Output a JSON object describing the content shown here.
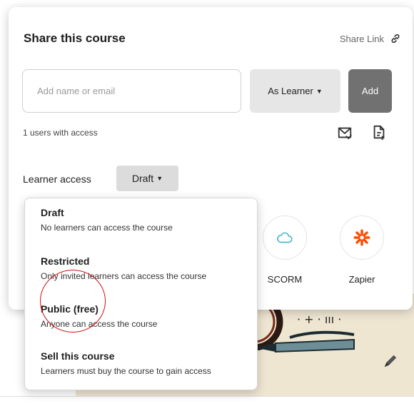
{
  "modal": {
    "title": "Share this course",
    "share_link_label": "Share Link"
  },
  "invite": {
    "placeholder": "Add name or email",
    "role_label": "As Learner",
    "add_label": "Add"
  },
  "users_count_text": "1 users with access",
  "access": {
    "label": "Learner access",
    "current": "Draft"
  },
  "integrations": [
    {
      "name": "SCORM",
      "icon": "cloud-icon",
      "color": "#45b7c4"
    },
    {
      "name": "Zapier",
      "icon": "zapier-icon",
      "color": "#ff4a00"
    }
  ],
  "dropdown": {
    "options": [
      {
        "title": "Draft",
        "description": "No learners can access the course"
      },
      {
        "title": "Restricted",
        "description": "Only invited learners can access the course"
      },
      {
        "title": "Public (free)",
        "description": "Anyone can access the course"
      },
      {
        "title": "Sell this course",
        "description": "Learners must buy the course to gain access"
      }
    ]
  },
  "colors": {
    "add_button": "#717171",
    "role_button": "#e6e6e6",
    "draft_button": "#dcdcdc",
    "highlight_circle": "#d01010"
  }
}
